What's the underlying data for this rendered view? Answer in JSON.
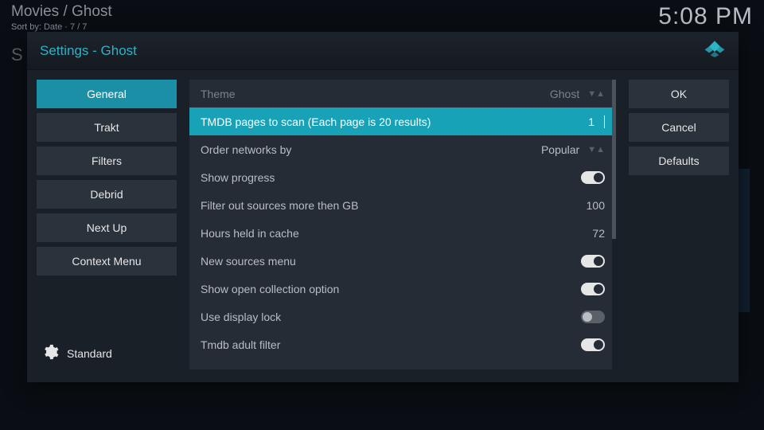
{
  "header": {
    "breadcrumb": "Movies / Ghost",
    "sort_line": "Sort by: Date  ·  7 / 7",
    "clock": "5:08 PM"
  },
  "modal": {
    "title": "Settings - Ghost"
  },
  "categories": {
    "c0": "General",
    "c1": "Trakt",
    "c2": "Filters",
    "c3": "Debrid",
    "c4": "Next Up",
    "c5": "Context Menu"
  },
  "level_label": "Standard",
  "settings": {
    "theme_label": "Theme",
    "theme_value": "Ghost",
    "pages_label": "TMDB pages to scan (Each page is 20 results)",
    "pages_value": "1",
    "order_label": "Order networks by",
    "order_value": "Popular",
    "progress_label": "Show progress",
    "filter_gb_label": "Filter out sources more then GB",
    "filter_gb_value": "100",
    "cache_label": "Hours held in cache",
    "cache_value": "72",
    "new_src_label": "New sources menu",
    "open_coll_label": "Show open collection option",
    "display_lock_label": "Use display lock",
    "adult_label": "Tmdb adult filter"
  },
  "actions": {
    "ok": "OK",
    "cancel": "Cancel",
    "defaults": "Defaults"
  }
}
